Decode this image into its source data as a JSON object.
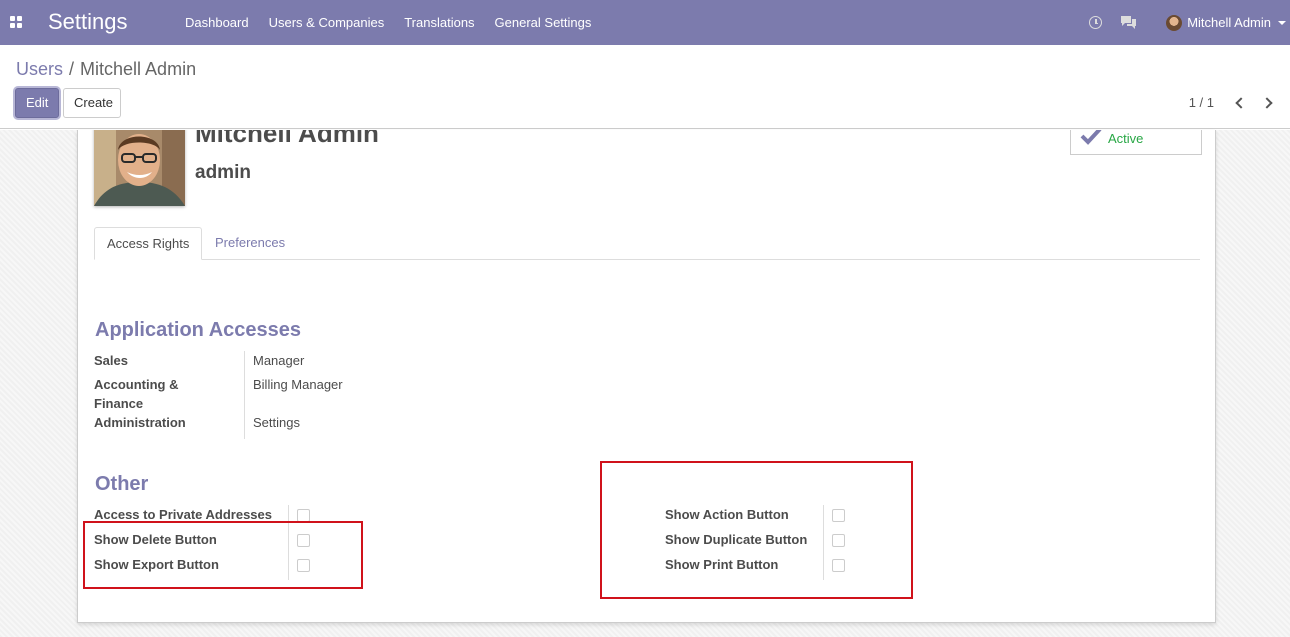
{
  "navbar": {
    "app_title": "Settings",
    "menu": [
      "Dashboard",
      "Users & Companies",
      "Translations",
      "General Settings"
    ],
    "user_name": "Mitchell Admin",
    "bg_color": "#7c7bad"
  },
  "control_panel": {
    "breadcrumb_parent": "Users",
    "breadcrumb_sep": "/",
    "breadcrumb_current": "Mitchell Admin",
    "edit_label": "Edit",
    "create_label": "Create",
    "pager_value": "1 / 1"
  },
  "record": {
    "name": "Mitchell Admin",
    "login": "admin",
    "active_label": "Active"
  },
  "tabs": [
    "Access Rights",
    "Preferences"
  ],
  "app_accesses": {
    "title": "Application Accesses",
    "rows": [
      {
        "label": "Sales",
        "value": "Manager"
      },
      {
        "label": "Accounting & Finance",
        "value": "Billing Manager"
      },
      {
        "label": "Administration",
        "value": "Settings"
      }
    ]
  },
  "other": {
    "title": "Other",
    "left": [
      {
        "label": "Access to Private Addresses",
        "checked": false
      },
      {
        "label": "Show Delete Button",
        "checked": false
      },
      {
        "label": "Show Export Button",
        "checked": false
      }
    ],
    "right": [
      {
        "label": "Show Action Button",
        "checked": false
      },
      {
        "label": "Show Duplicate Button",
        "checked": false
      },
      {
        "label": "Show Print Button",
        "checked": false
      }
    ]
  },
  "colors": {
    "accent": "#7c7bad",
    "active": "#28a745",
    "highlight": "#d0121b"
  }
}
